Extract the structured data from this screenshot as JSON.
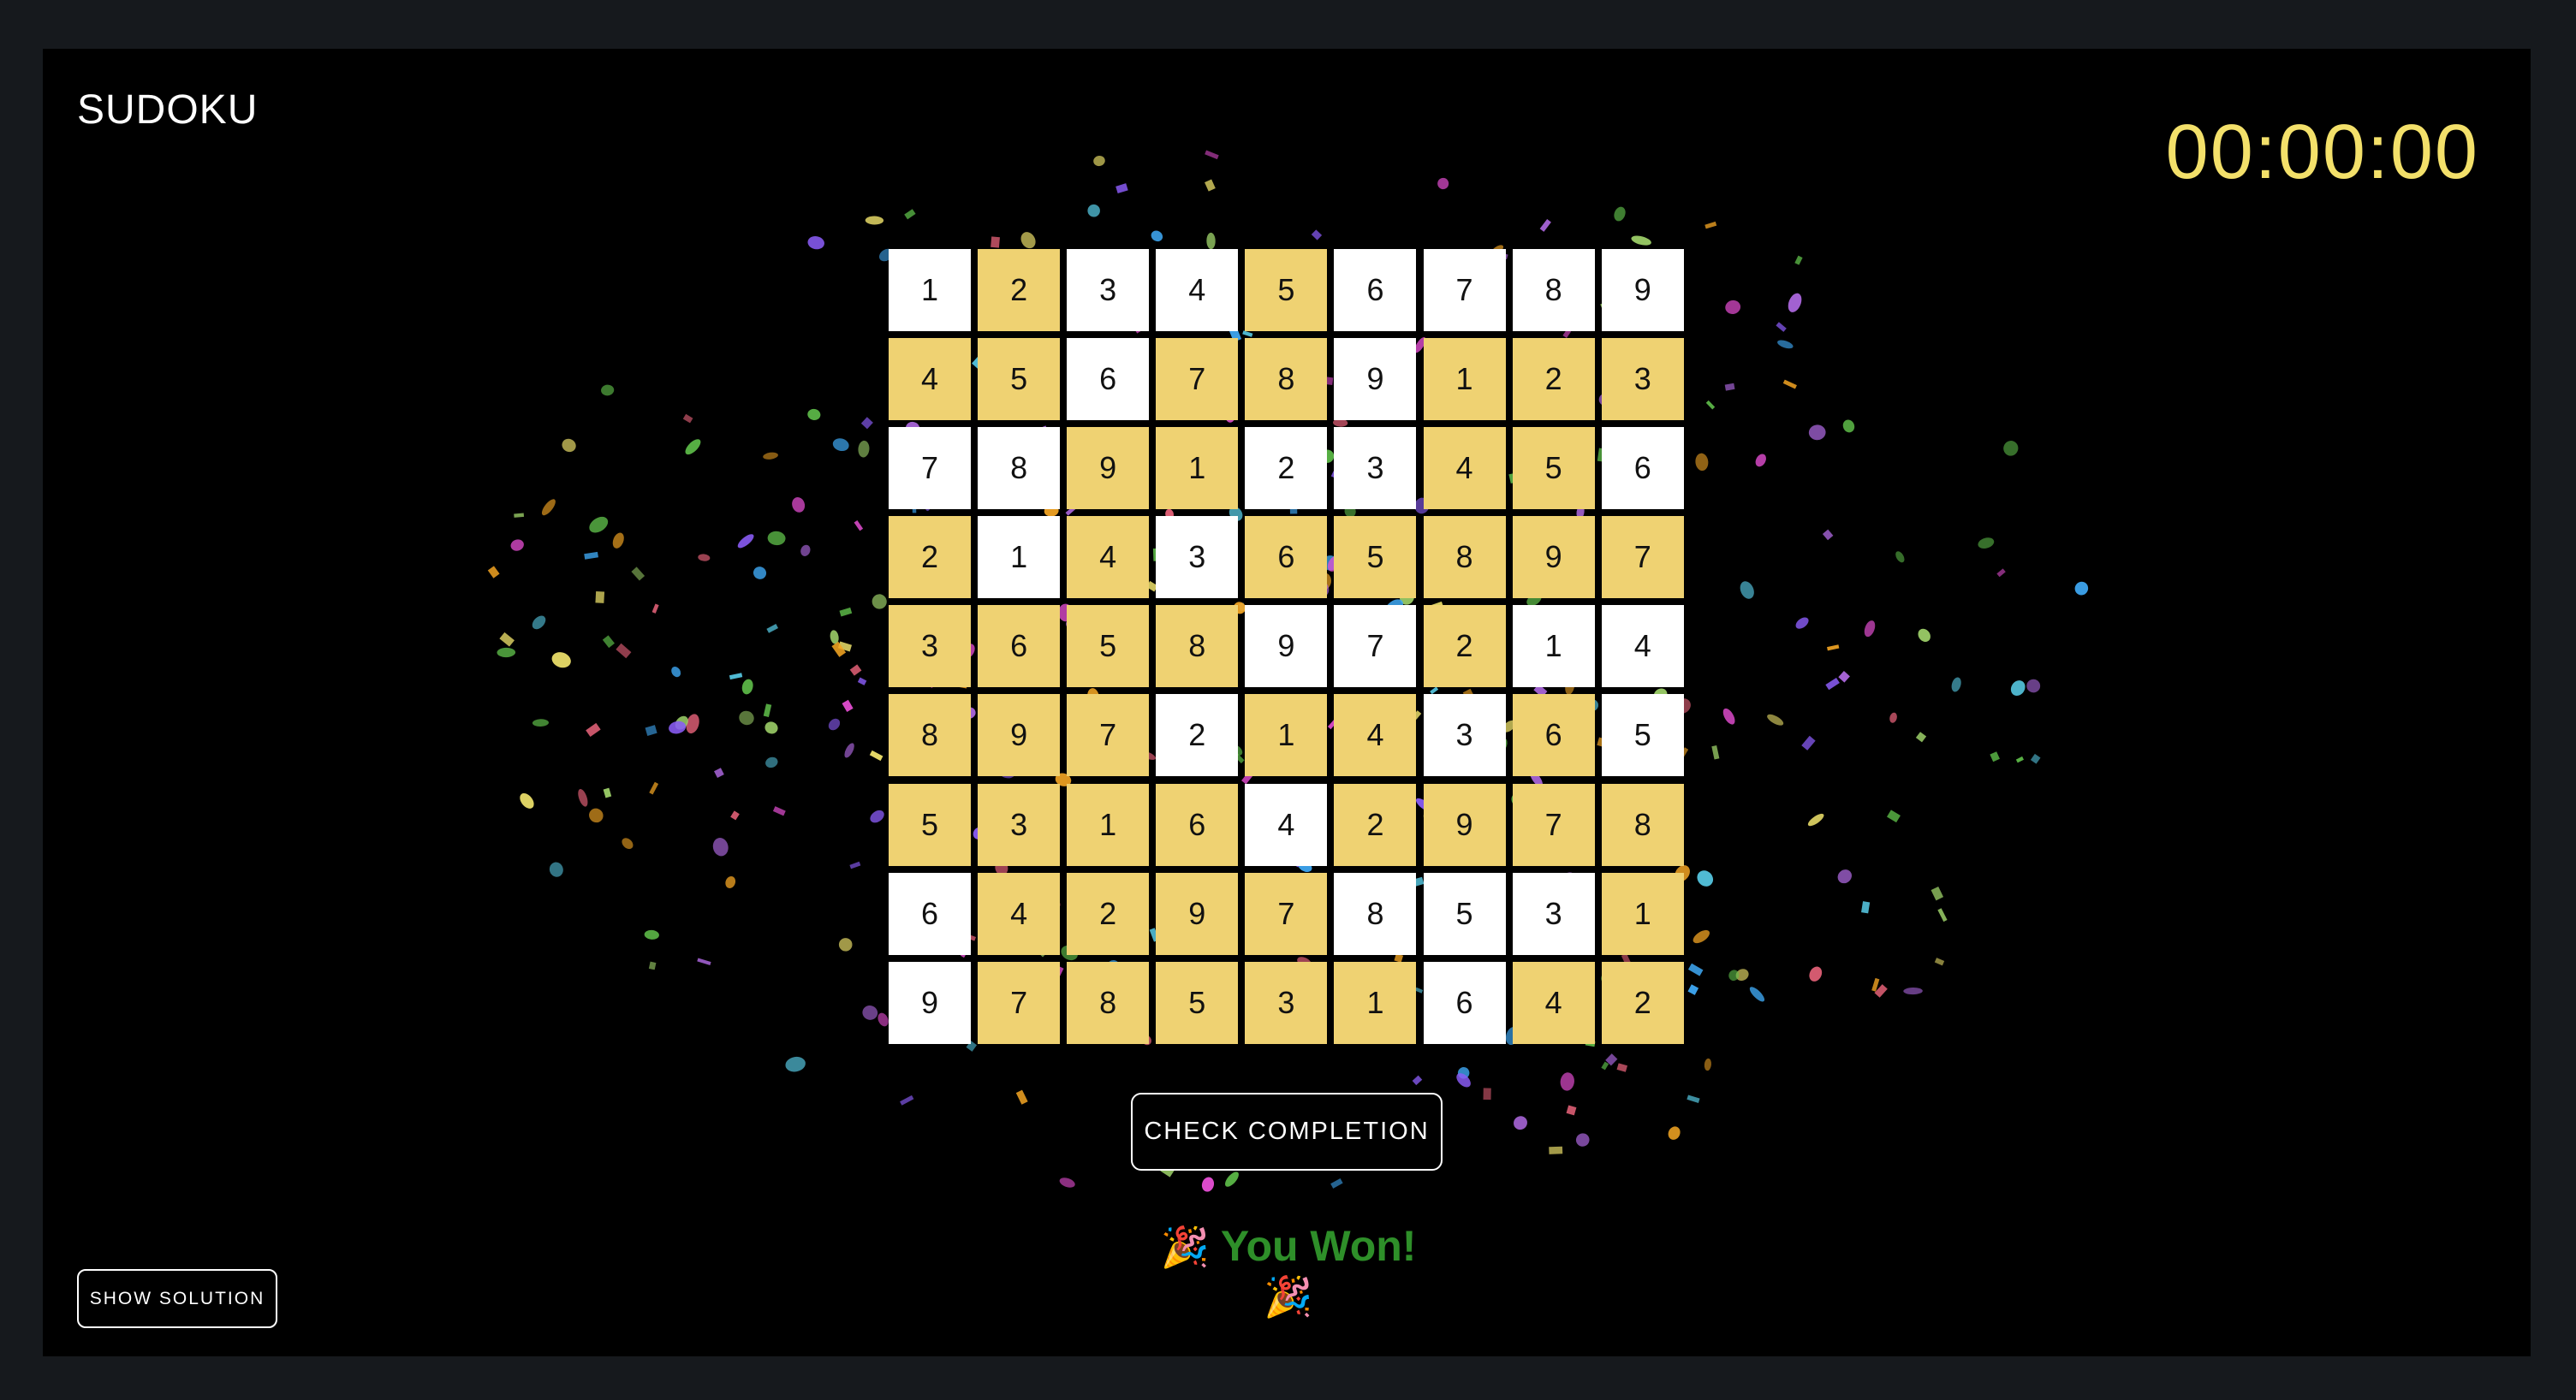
{
  "header": {
    "title": "SUDOKU",
    "timer": "00:00:00"
  },
  "board": {
    "rows": [
      [
        1,
        2,
        3,
        4,
        5,
        6,
        7,
        8,
        9
      ],
      [
        4,
        5,
        6,
        7,
        8,
        9,
        1,
        2,
        3
      ],
      [
        7,
        8,
        9,
        1,
        2,
        3,
        4,
        5,
        6
      ],
      [
        2,
        1,
        4,
        3,
        6,
        5,
        8,
        9,
        7
      ],
      [
        3,
        6,
        5,
        8,
        9,
        7,
        2,
        1,
        4
      ],
      [
        8,
        9,
        7,
        2,
        1,
        4,
        3,
        6,
        5
      ],
      [
        5,
        3,
        1,
        6,
        4,
        2,
        9,
        7,
        8
      ],
      [
        6,
        4,
        2,
        9,
        7,
        8,
        5,
        3,
        1
      ],
      [
        9,
        7,
        8,
        5,
        3,
        1,
        6,
        4,
        2
      ]
    ],
    "given": [
      [
        1,
        0,
        1,
        1,
        0,
        1,
        1,
        1,
        1
      ],
      [
        0,
        0,
        1,
        0,
        0,
        1,
        0,
        0,
        0
      ],
      [
        1,
        1,
        0,
        0,
        1,
        1,
        0,
        0,
        1
      ],
      [
        0,
        1,
        0,
        1,
        0,
        0,
        0,
        0,
        0
      ],
      [
        0,
        0,
        0,
        0,
        1,
        1,
        0,
        1,
        1
      ],
      [
        0,
        0,
        0,
        1,
        0,
        0,
        1,
        0,
        1
      ],
      [
        0,
        0,
        0,
        0,
        1,
        0,
        0,
        0,
        0
      ],
      [
        1,
        0,
        0,
        0,
        0,
        1,
        1,
        1,
        0
      ],
      [
        1,
        0,
        0,
        0,
        0,
        0,
        1,
        0,
        0
      ]
    ],
    "colors": {
      "given": "#ffffff",
      "filled": "#efd272"
    }
  },
  "actions": {
    "check_label": "CHECK COMPLETION",
    "solution_label": "SHOW SOLUTION"
  },
  "status": {
    "message": "You Won!",
    "emoji_left": "🎉",
    "emoji_right": "🎉",
    "color": "#2e8f29"
  }
}
